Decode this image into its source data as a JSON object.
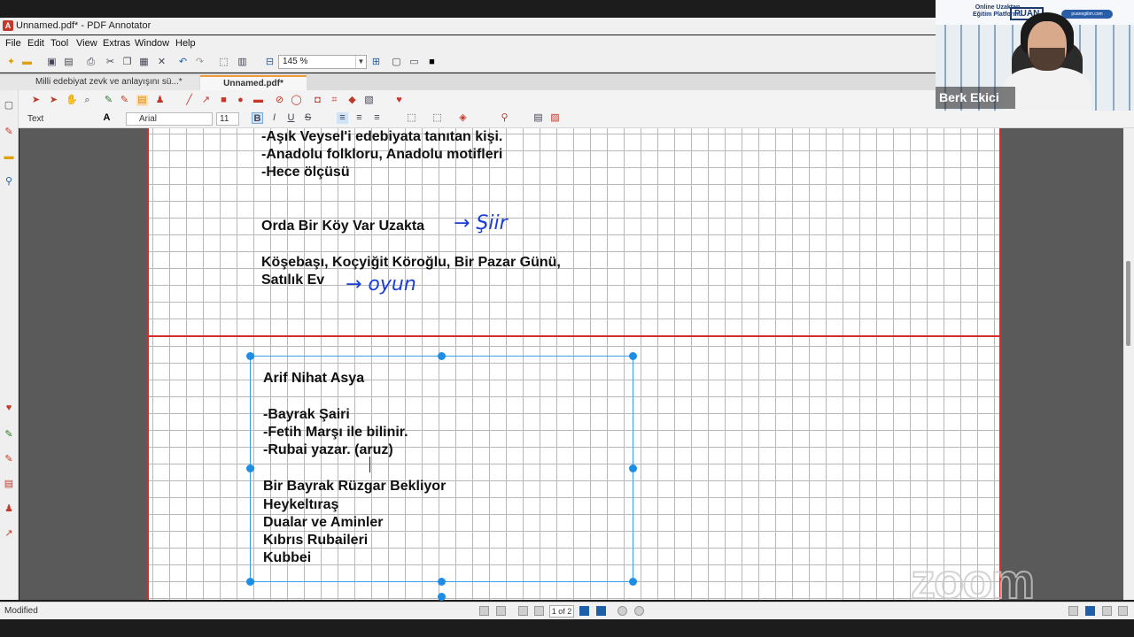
{
  "window": {
    "title": "Unnamed.pdf* - PDF Annotator",
    "app_icon_letter": "A"
  },
  "menu": [
    "File",
    "Edit",
    "Tool",
    "View",
    "Extras",
    "Window",
    "Help"
  ],
  "toolbar": {
    "zoom_value": "145 %"
  },
  "tabs": [
    {
      "label": "Milli edebiyat zevk ve anlayışını sü...*",
      "active": false
    },
    {
      "label": "Unnamed.pdf*",
      "active": true
    }
  ],
  "text_toolbar": {
    "tool_label": "Text",
    "font_name": "Arial",
    "font_size": "11",
    "bold": "B",
    "italic": "I",
    "underline": "U",
    "strike": "S"
  },
  "page1": {
    "lines": [
      "-Aşık Veysel'i edebiyata tanıtan kişi.",
      "-Anadolu folkloru, Anadolu motifleri",
      "-Hece ölçüsü"
    ],
    "line_orda": "Orda Bir Köy Var Uzakta",
    "hand_siir": "→ Şiir",
    "line_kosebasi": "Köşebaşı, Koçyiğit Köroğlu, Bir Pazar Günü,",
    "line_satilik": "Satılık Ev",
    "hand_oyun": "→ oyun"
  },
  "page2": {
    "title": "Arif Nihat Asya",
    "facts": [
      "-Bayrak Şairi",
      "-Fetih Marşı ile bilinir.",
      "-Rubai yazar. (aruz)"
    ],
    "works": [
      "Bir Bayrak Rüzgar Bekliyor",
      "Heykeltıraş",
      "Dualar ve Aminler",
      "Kıbrıs Rubaileri",
      "Kubbei"
    ]
  },
  "status": {
    "text": "Modified",
    "page_indicator": "1 of 2"
  },
  "webcam": {
    "participant_name": "Berk Ekici",
    "brand_line": "Online Uzaktan Eğitim Platformu",
    "brand_logo": "PUAN",
    "brand_url": "puanegitim.com"
  },
  "watermark": "zoom",
  "colors": {
    "page_border": "#d12b2b",
    "handwriting": "#1a3fd8",
    "selection": "#1e8de6"
  }
}
